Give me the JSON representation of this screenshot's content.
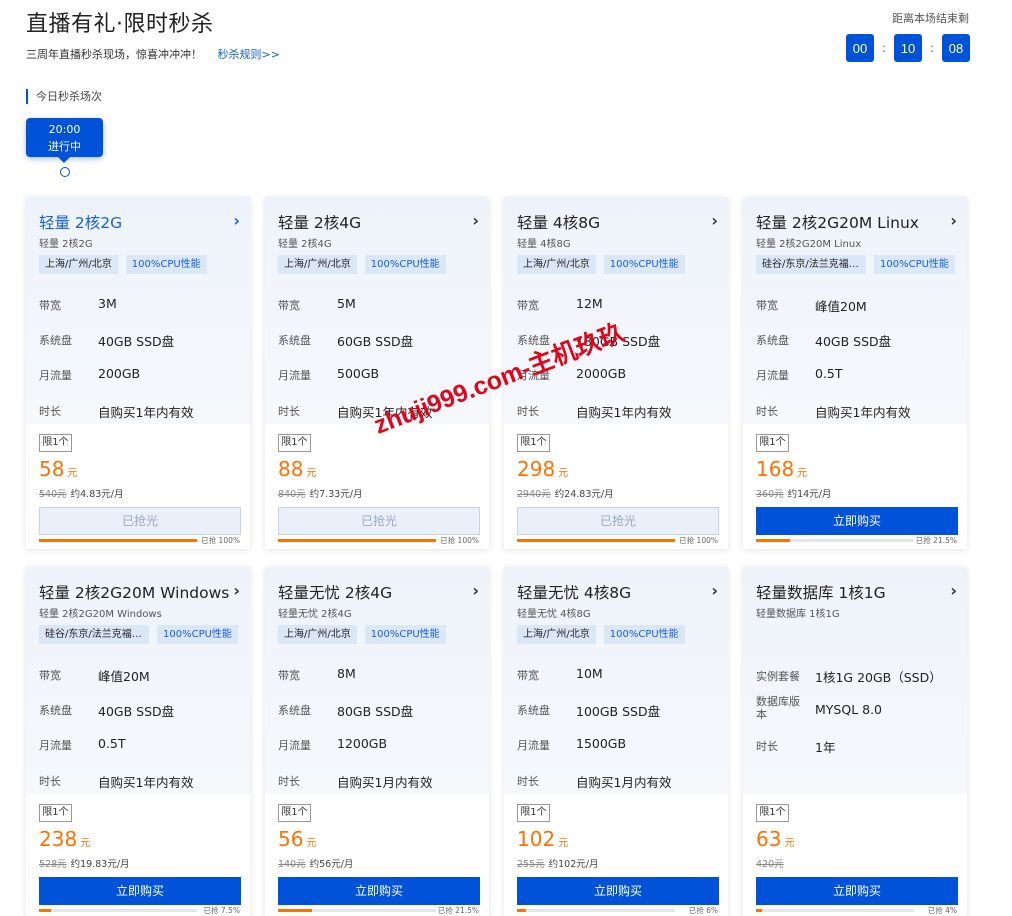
{
  "header": {
    "title": "直播有礼·限时秒杀",
    "subtitle": "三周年直播秒杀现场，惊喜冲冲冲！",
    "rules_link": "秒杀规则>>",
    "countdown_label": "距离本场结束剩",
    "countdown": {
      "hours": "00",
      "minutes": "10",
      "seconds": "08",
      "separator": ":"
    }
  },
  "session_section": {
    "label": "今日秒杀场次",
    "session": {
      "time": "20:00",
      "status": "进行中"
    }
  },
  "watermark": "zhuji999.com-主机玖玖",
  "cards": [
    {
      "title": "轻量 2核2G",
      "subtitle": "轻量 2核2G",
      "tags": [
        "上海/广州/北京",
        "100%CPU性能"
      ],
      "specs": [
        [
          "带宽",
          "3M"
        ],
        [
          "系统盘",
          "40GB SSD盘"
        ],
        [
          "月流量",
          "200GB"
        ],
        [
          "时长",
          "自购买1年内有效"
        ]
      ],
      "limit": "限1个",
      "price": "58",
      "unit": "元",
      "original": "540元",
      "monthly": "约4.83元/月",
      "button": "已抢光",
      "sold_out": true,
      "progress": 100,
      "progress_text": "已抢 100%",
      "active": true
    },
    {
      "title": "轻量 2核4G",
      "subtitle": "轻量 2核4G",
      "tags": [
        "上海/广州/北京",
        "100%CPU性能"
      ],
      "specs": [
        [
          "带宽",
          "5M"
        ],
        [
          "系统盘",
          "60GB SSD盘"
        ],
        [
          "月流量",
          "500GB"
        ],
        [
          "时长",
          "自购买1年内有效"
        ]
      ],
      "limit": "限1个",
      "price": "88",
      "unit": "元",
      "original": "840元",
      "monthly": "约7.33元/月",
      "button": "已抢光",
      "sold_out": true,
      "progress": 100,
      "progress_text": "已抢 100%"
    },
    {
      "title": "轻量 4核8G",
      "subtitle": "轻量 4核8G",
      "tags": [
        "上海/广州/北京",
        "100%CPU性能"
      ],
      "specs": [
        [
          "带宽",
          "12M"
        ],
        [
          "系统盘",
          "180GB SSD盘"
        ],
        [
          "月流量",
          "2000GB"
        ],
        [
          "时长",
          "自购买1年内有效"
        ]
      ],
      "limit": "限1个",
      "price": "298",
      "unit": "元",
      "original": "2940元",
      "monthly": "约24.83元/月",
      "button": "已抢光",
      "sold_out": true,
      "progress": 100,
      "progress_text": "已抢 100%"
    },
    {
      "title": "轻量 2核2G20M Linux",
      "subtitle": "轻量 2核2G20M Linux",
      "tags": [
        "硅谷/东京/法兰克福/...",
        "100%CPU性能"
      ],
      "specs": [
        [
          "带宽",
          "峰值20M"
        ],
        [
          "系统盘",
          "40GB SSD盘"
        ],
        [
          "月流量",
          "0.5T"
        ],
        [
          "时长",
          "自购买1年内有效"
        ]
      ],
      "limit": "限1个",
      "price": "168",
      "unit": "元",
      "original": "360元",
      "monthly": "约14元/月",
      "button": "立即购买",
      "sold_out": false,
      "progress": 21.5,
      "progress_text": "已抢 21.5%"
    },
    {
      "title": "轻量 2核2G20M Windows",
      "subtitle": "轻量 2核2G20M Windows",
      "tags": [
        "硅谷/东京/法兰克福/...",
        "100%CPU性能"
      ],
      "specs": [
        [
          "带宽",
          "峰值20M"
        ],
        [
          "系统盘",
          "40GB SSD盘"
        ],
        [
          "月流量",
          "0.5T"
        ],
        [
          "时长",
          "自购买1年内有效"
        ]
      ],
      "limit": "限1个",
      "price": "238",
      "unit": "元",
      "original": "528元",
      "monthly": "约19.83元/月",
      "button": "立即购买",
      "sold_out": false,
      "progress": 7.5,
      "progress_text": "已抢 7.5%"
    },
    {
      "title": "轻量无忧 2核4G",
      "subtitle": "轻量无忧 2核4G",
      "tags": [
        "上海/广州/北京",
        "100%CPU性能"
      ],
      "specs": [
        [
          "带宽",
          "8M"
        ],
        [
          "系统盘",
          "80GB SSD盘"
        ],
        [
          "月流量",
          "1200GB"
        ],
        [
          "时长",
          "自购买1月内有效"
        ]
      ],
      "limit": "限1个",
      "price": "56",
      "unit": "元",
      "original": "140元",
      "monthly": "约56元/月",
      "button": "立即购买",
      "sold_out": false,
      "progress": 21.5,
      "progress_text": "已抢 21.5%"
    },
    {
      "title": "轻量无忧 4核8G",
      "subtitle": "轻量无忧 4核8G",
      "tags": [
        "上海/广州/北京",
        "100%CPU性能"
      ],
      "specs": [
        [
          "带宽",
          "10M"
        ],
        [
          "系统盘",
          "100GB SSD盘"
        ],
        [
          "月流量",
          "1500GB"
        ],
        [
          "时长",
          "自购买1月内有效"
        ]
      ],
      "limit": "限1个",
      "price": "102",
      "unit": "元",
      "original": "255元",
      "monthly": "约102元/月",
      "button": "立即购买",
      "sold_out": false,
      "progress": 6,
      "progress_text": "已抢 6%"
    },
    {
      "title": "轻量数据库 1核1G",
      "subtitle": "轻量数据库 1核1G",
      "tags": [],
      "specs": [
        [
          "实例套餐",
          "1核1G 20GB（SSD）"
        ],
        [
          "数据库版本",
          "MYSQL 8.0"
        ],
        [
          "时长",
          "1年"
        ]
      ],
      "limit": "限1个",
      "price": "63",
      "unit": "元",
      "original": "420元",
      "monthly": "",
      "button": "立即购买",
      "sold_out": false,
      "progress": 4,
      "progress_text": "已抢 4%"
    }
  ]
}
